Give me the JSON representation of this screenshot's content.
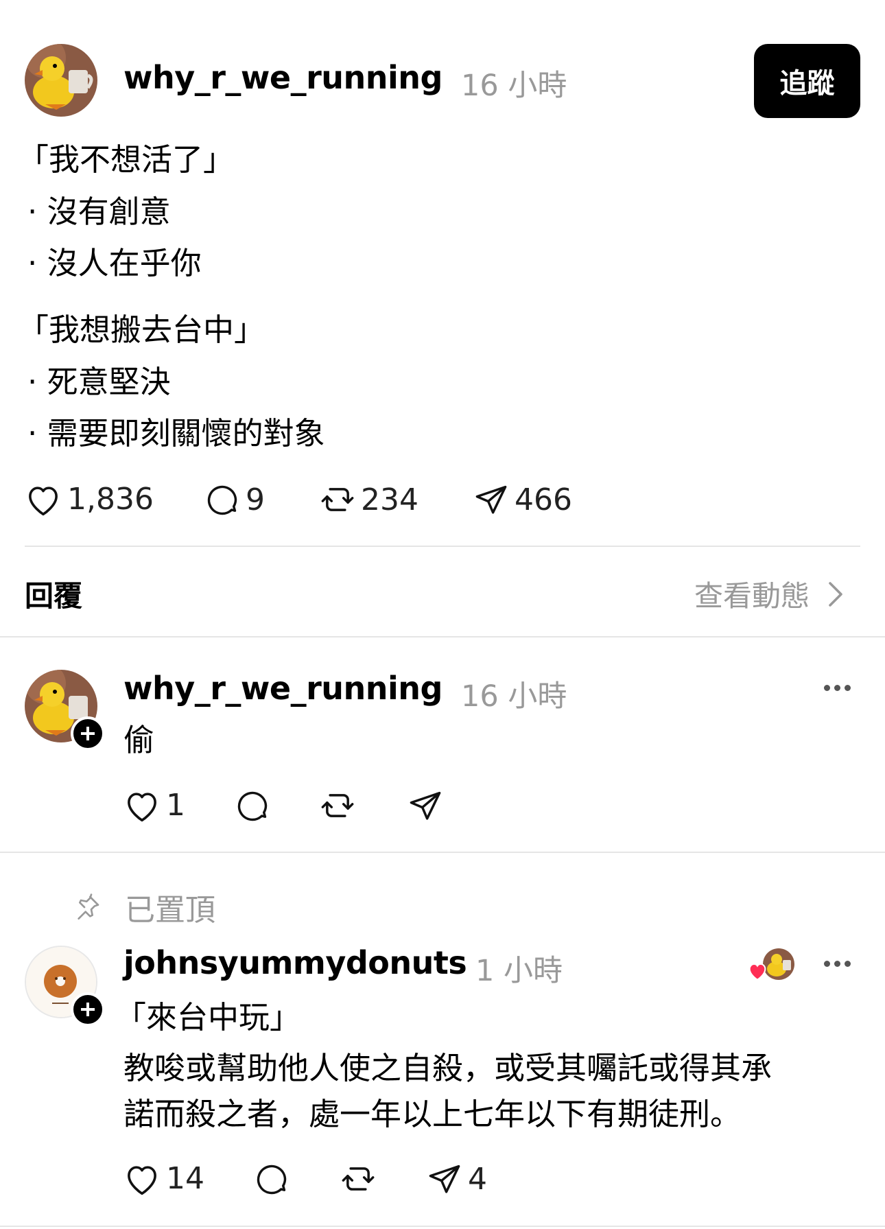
{
  "post": {
    "username": "why_r_we_running",
    "time": "16 小時",
    "follow_label": "追蹤",
    "lines": [
      "「我不想活了」",
      "· 沒有創意",
      "· 沒人在乎你",
      "「我想搬去台中」",
      "· 死意堅決",
      "· 需要即刻關懷的對象"
    ],
    "likes": "1,836",
    "comments": "9",
    "reposts": "234",
    "shares": "466"
  },
  "replies_header": {
    "label": "回覆",
    "view_activity": "查看動態"
  },
  "reply1": {
    "username": "why_r_we_running",
    "time": "16 小時",
    "text": "偷",
    "likes": "1"
  },
  "pinned_label": "已置頂",
  "reply2": {
    "username": "johnsyummydonuts",
    "time": "1 小時",
    "line1": "「來台中玩」",
    "line2": "教唆或幫助他人使之自殺，或受其囑託或得其承",
    "line3": "諾而殺之者，處一年以上七年以下有期徒刑。",
    "likes": "14",
    "shares": "4"
  },
  "icons": [
    "heart-icon",
    "comment-icon",
    "repost-icon",
    "share-icon",
    "more-icon",
    "pin-icon",
    "chevron-right-icon",
    "plus-icon"
  ],
  "colors": {
    "accent": "#000000",
    "muted": "#999999",
    "liked_heart": "#ff2d55"
  }
}
